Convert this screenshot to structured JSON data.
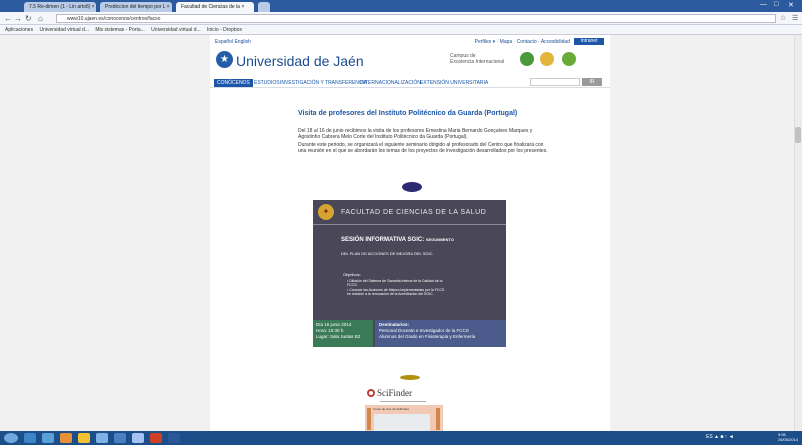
{
  "browser": {
    "tabs": [
      {
        "label": "7.5 Re-dimen (1 - Lin arto6) ×"
      },
      {
        "label": "Prediccion del tiempo por L ×"
      },
      {
        "label": "Facultad de Ciencias de la ×"
      }
    ],
    "url": "www10.ujaen.es/conocenos/centros/facso",
    "bookmarks": [
      "Aplicaciones",
      "Universidad virtual d...",
      "Mis sistemas - Porta...",
      "Universidad virtual d...",
      "Inicio - Dropbox"
    ]
  },
  "site": {
    "languages": [
      "Español",
      "English"
    ],
    "toplinks": [
      "Perfiles ▾",
      "Mapa",
      "Contacto",
      "Accesibilidad"
    ],
    "intranet": "Intranet",
    "logo_text": "Universidad de Jaén",
    "campus_line1": "Campus de",
    "campus_line2": "Excelencia Internacional",
    "menu": [
      "CONÓCENOS",
      "ESTUDIOS",
      "INVESTIGACIÓN Y TRANSFERENCIA",
      "INTERNACIONALIZACIÓN",
      "EXTENSIÓN UNIVERSITARIA"
    ],
    "search_button": "IR"
  },
  "article": {
    "title": "Visita de profesores del Instituto Politécnico da Guarda (Portugal)",
    "para1": "Del 18 al 16 de junio recibimos la visita de los profesores Ernestina Maria Bernardo Gonçalves Marques y Agostinho Cabrera Melo Corte del Instituto Politécnico da Guarda (Portugal).",
    "para2": "Durante este periodo, se organizará el siguiente seminario dirigido al profesorado del Centro que finalizará con una reunión en el que se abordarán los temas de los proyectos de investigación desarrollados por los presentes."
  },
  "poster": {
    "header": "FACULTAD DE CIENCIAS DE LA SALUD",
    "title": "SESIÓN INFORMATIVA SGIC:",
    "title_rest": "SEGUIMIENTO",
    "subtitle": "DEL PLAN DE ACCIONES DE MEJORA DEL SGIC.",
    "objectives_label": "Objetivos:",
    "bullets": [
      "• Difusión del Sistema de Garantía Interna de la Calidad de la",
      "  FCCS.",
      "• Conocer las Acciones de Mejora implementadas por la FCCS",
      "  en relación a la renovación de la Acreditación del SGIC."
    ],
    "left": [
      "Día 16 junio 2014",
      "Hora: 10:30 h.",
      "Lugar: Sala Juntas B2"
    ],
    "right": [
      "Destinatarios:",
      "Personal Docente e Investigador de la FCCS",
      "Alumnos del Grado en Fisioterapia y Enfermería"
    ]
  },
  "scifinder": {
    "label": "SciFinder",
    "card_header": "Curso de Uso de SciFinder"
  },
  "taskbar": {
    "tray": "ES ▲ ■ ↑ ◄",
    "time": "9:55",
    "date": "26/05/2014"
  }
}
